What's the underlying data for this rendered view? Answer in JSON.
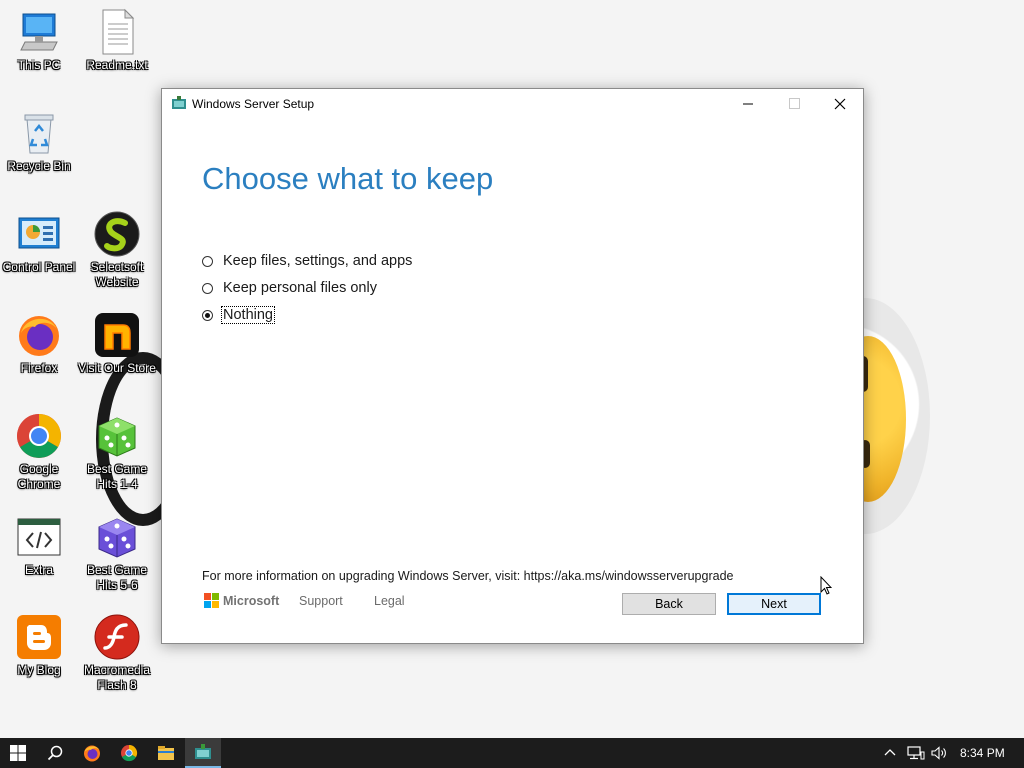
{
  "desktop": {
    "icons": [
      {
        "label": "This PC"
      },
      {
        "label": "Readme.txt"
      },
      {
        "label": "Recycle Bin"
      },
      {
        "label": "Control Panel"
      },
      {
        "label": "Selectsoft Website"
      },
      {
        "label": "Firefox"
      },
      {
        "label": "Visit Our Store"
      },
      {
        "label": "Google Chrome"
      },
      {
        "label": "Best Game Hits 1-4"
      },
      {
        "label": "Extra"
      },
      {
        "label": "Best Game Hits 5-6"
      },
      {
        "label": "My Blog"
      },
      {
        "label": "Macromedia Flash 8"
      }
    ]
  },
  "window": {
    "title": "Windows Server Setup",
    "heading": "Choose what to keep",
    "options": [
      {
        "label": "Keep files, settings, and apps",
        "selected": false
      },
      {
        "label": "Keep personal files only",
        "selected": false
      },
      {
        "label": "Nothing",
        "selected": true
      }
    ],
    "info_text": "For more information on upgrading Windows Server, visit: https://aka.ms/windowsserverupgrade",
    "brand": "Microsoft",
    "links": [
      "Support",
      "Legal"
    ],
    "buttons": {
      "back": "Back",
      "next": "Next"
    }
  },
  "taskbar": {
    "clock": "8:34 PM"
  },
  "colors": {
    "heading": "#2b7fc0",
    "accent": "#0078d7",
    "taskbar": "#1c1c1c"
  }
}
